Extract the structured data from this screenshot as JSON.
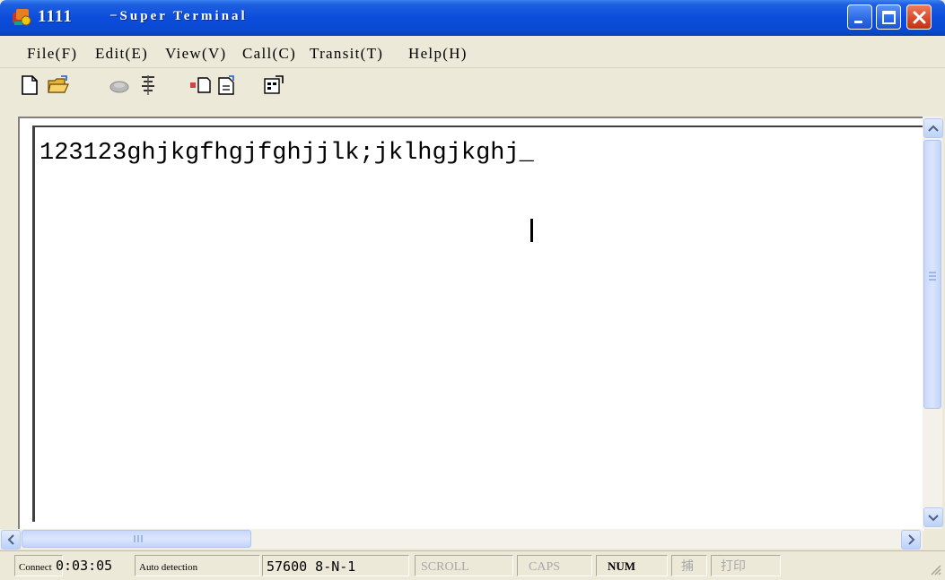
{
  "window": {
    "title_name": "1111",
    "title_app": "−Super Terminal"
  },
  "menu": [
    {
      "label": "File(F)"
    },
    {
      "label": "Edit(E)"
    },
    {
      "label": "View(V)"
    },
    {
      "label": "Call(C)"
    },
    {
      "label": "Transit(T)"
    },
    {
      "label": "Help(H)"
    }
  ],
  "toolbar": {
    "icons": [
      "new-file-icon",
      "open-folder-icon",
      "call-icon",
      "disconnect-icon",
      "send-icon",
      "receive-icon",
      "properties-icon"
    ]
  },
  "terminal": {
    "text": "123123ghjkgfhgjfghjjlk;jklhgjkghj_"
  },
  "status": {
    "connection_label": "Connect",
    "elapsed": "0:03:05",
    "detection": "Auto detection",
    "baud": "57600 8-N-1",
    "scroll": "SCROLL",
    "caps": "CAPS",
    "num": "NUM",
    "capture": "捕",
    "print": "打印"
  },
  "colors": {
    "titlebar": "#0b4ddb",
    "close_button": "#d8472a",
    "chrome": "#ece9d8"
  }
}
